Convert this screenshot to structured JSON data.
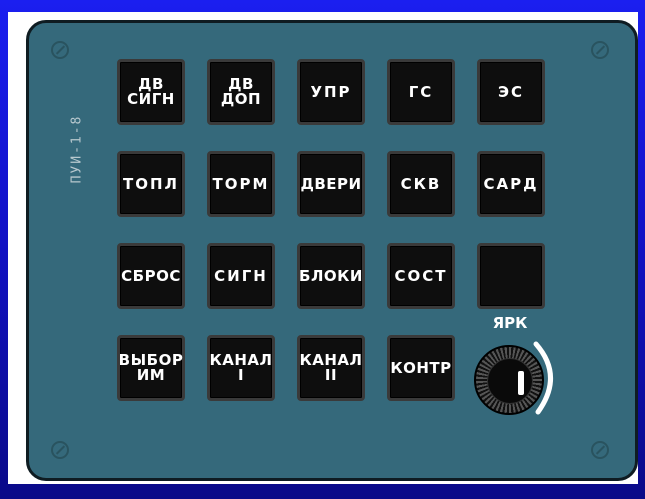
{
  "panel": {
    "label": "ПУИ-1-8",
    "keys": [
      {
        "label": "ДВ\nСИГН"
      },
      {
        "label": "ДВ\nДОП"
      },
      {
        "label": "УПР"
      },
      {
        "label": "ГС"
      },
      {
        "label": "ЭС"
      },
      {
        "label": "ТОПЛ"
      },
      {
        "label": "ТОРМ"
      },
      {
        "label": "ДВЕРИ"
      },
      {
        "label": "СКВ"
      },
      {
        "label": "САРД"
      },
      {
        "label": "СБРОС"
      },
      {
        "label": "СИГН"
      },
      {
        "label": "БЛОКИ"
      },
      {
        "label": "СОСТ"
      },
      {
        "label": ""
      },
      {
        "label": "ВЫБОР\nИМ"
      },
      {
        "label": "КАНАЛ\nI"
      },
      {
        "label": "КАНАЛ\nII"
      },
      {
        "label": "КОНТР"
      }
    ],
    "knob": {
      "label": "ЯРК"
    }
  },
  "colors": {
    "background": "#1b1ff0",
    "panel": "#35697b",
    "key": "#0e0e0e",
    "key_text": "#ffffff"
  }
}
